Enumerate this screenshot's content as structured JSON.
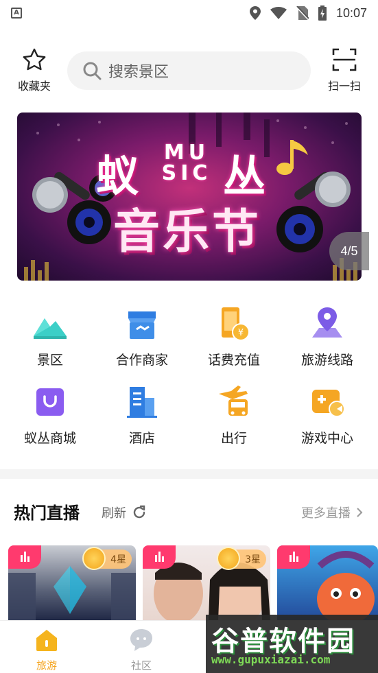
{
  "status_bar": {
    "time": "10:07",
    "notification_letter": "A"
  },
  "header": {
    "favorites_label": "收藏夹",
    "search_placeholder": "搜索景区",
    "scan_label": "扫一扫"
  },
  "banner": {
    "title_left": "蚁",
    "title_right": "丛",
    "music_line1": "MU",
    "music_line2": "SIC",
    "subtitle": "音乐节",
    "page_indicator": "4/5"
  },
  "grid": {
    "items": [
      {
        "label": "景区",
        "icon": "mountain-icon"
      },
      {
        "label": "合作商家",
        "icon": "store-icon"
      },
      {
        "label": "话费充值",
        "icon": "phone-recharge-icon"
      },
      {
        "label": "旅游线路",
        "icon": "route-pin-icon"
      },
      {
        "label": "蚁丛商城",
        "icon": "shopping-bag-icon"
      },
      {
        "label": "酒店",
        "icon": "hotel-building-icon"
      },
      {
        "label": "出行",
        "icon": "travel-bus-plane-icon"
      },
      {
        "label": "游戏中心",
        "icon": "game-controller-icon"
      }
    ]
  },
  "live": {
    "title": "热门直播",
    "refresh_label": "刷新",
    "more_label": "更多直播",
    "cards": [
      {
        "stars": "4星"
      },
      {
        "stars": "3星"
      },
      {
        "stars": ""
      }
    ]
  },
  "bottom_nav": {
    "items": [
      {
        "label": "旅游",
        "active": true
      },
      {
        "label": "社区",
        "active": false
      }
    ]
  },
  "watermark": {
    "title": "谷普软件园",
    "url": "www.gupuxiazai.com"
  },
  "colors": {
    "accent": "#f5b41e",
    "live_badge": "#ff3a6e",
    "banner_pink": "#c2307a"
  }
}
